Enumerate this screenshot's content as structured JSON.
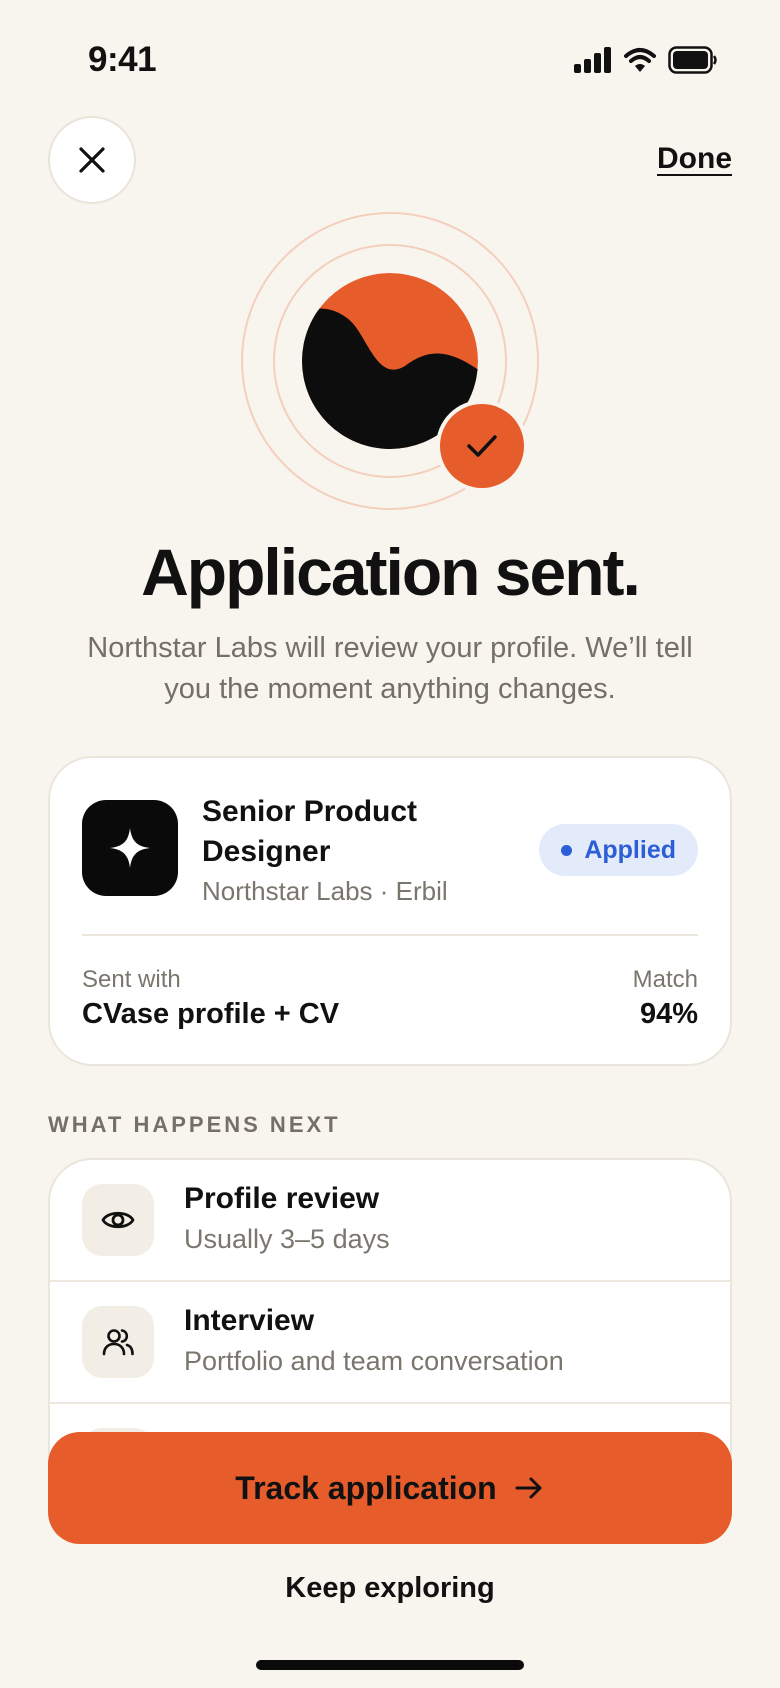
{
  "status_bar": {
    "time": "9:41"
  },
  "header": {
    "done_label": "Done"
  },
  "title": "Application sent.",
  "subtitle": "Northstar Labs will review your profile. We’ll tell you the moment anything changes.",
  "job": {
    "title": "Senior Product Designer",
    "company": "Northstar Labs · Erbil",
    "status": "Applied",
    "sent_with_label": "Sent with",
    "sent_with_value": "CVase profile + CV",
    "match_label": "Match",
    "match_value": "94%"
  },
  "next_section": {
    "label": "WHAT HAPPENS NEXT",
    "steps": [
      {
        "title": "Profile review",
        "subtitle": "Usually 3–5 days",
        "icon": "eye-icon"
      },
      {
        "title": "Interview",
        "subtitle": "Portfolio and team conversation",
        "icon": "users-icon"
      }
    ]
  },
  "cta": {
    "primary_label": "Track application",
    "secondary_label": "Keep exploring"
  },
  "colors": {
    "background": "#f8f5ee",
    "accent": "#e65c2b",
    "badge_bg": "#e3ebfb",
    "badge_text": "#2d5ed6",
    "text": "#111111",
    "muted": "#757067"
  }
}
